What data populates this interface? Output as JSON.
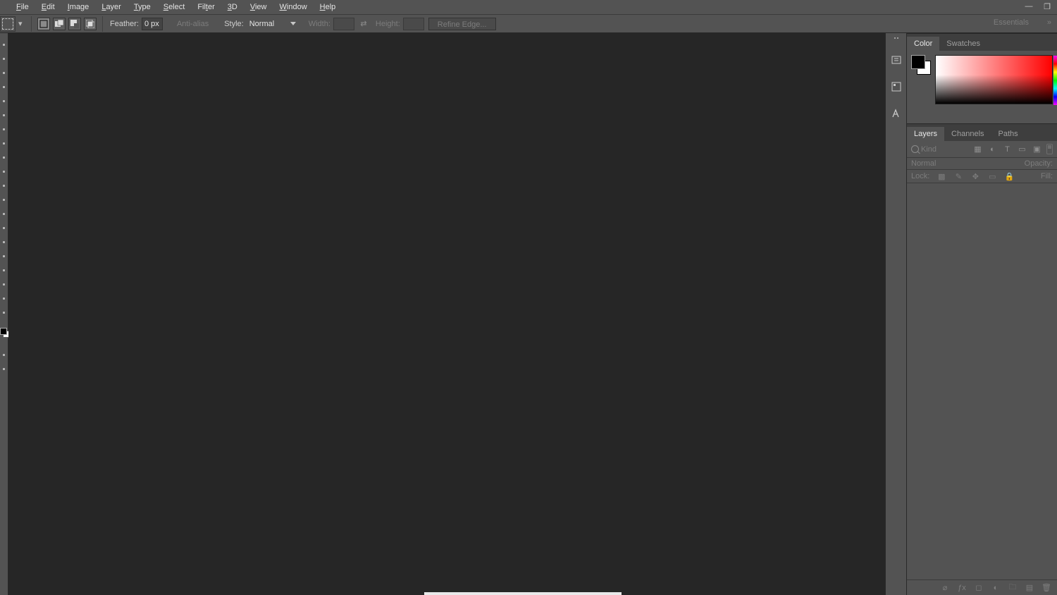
{
  "menu": {
    "items": [
      "File",
      "Edit",
      "Image",
      "Layer",
      "Type",
      "Select",
      "Filter",
      "3D",
      "View",
      "Window",
      "Help"
    ],
    "accel": [
      "F",
      "E",
      "I",
      "L",
      "T",
      "S",
      "F",
      "3",
      "V",
      "W",
      "H"
    ]
  },
  "options": {
    "feather_label": "Feather:",
    "feather_value": "0 px",
    "antialias_label": "Anti-alias",
    "style_label": "Style:",
    "style_value": "Normal",
    "width_label": "Width:",
    "height_label": "Height:",
    "refine_label": "Refine Edge...",
    "workspace": "Essentials"
  },
  "panels": {
    "color_tab": "Color",
    "swatches_tab": "Swatches",
    "layers_tab": "Layers",
    "channels_tab": "Channels",
    "paths_tab": "Paths",
    "filter_kind": "Kind",
    "blend_mode": "Normal",
    "opacity_label": "Opacity:",
    "lock_label": "Lock:",
    "fill_label": "Fill:"
  }
}
